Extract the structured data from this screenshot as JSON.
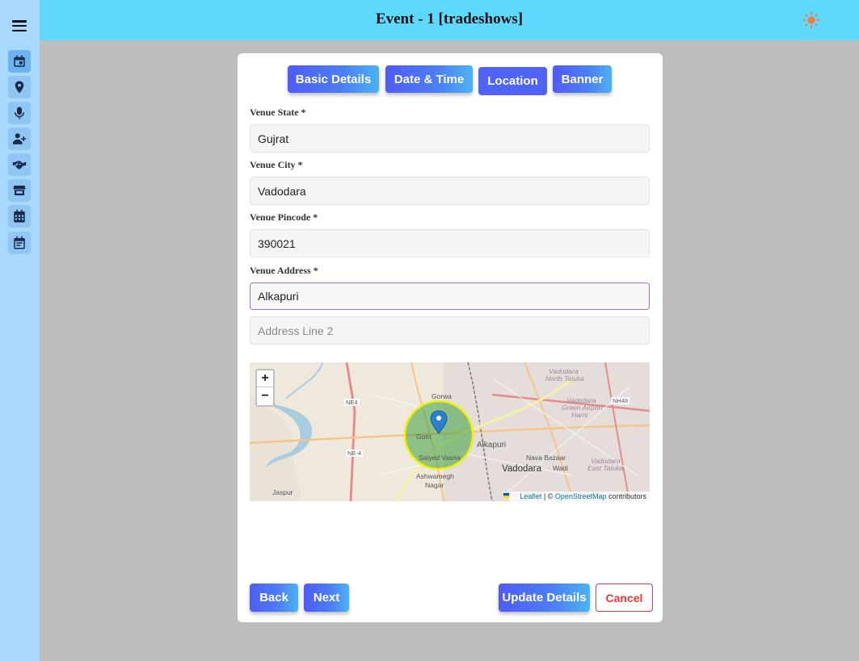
{
  "topbar": {
    "title": "Event - 1 [tradeshows]",
    "theme_icon": "sun-icon"
  },
  "sidebar": {
    "items": [
      {
        "icon": "calendar-day-icon",
        "active": true
      },
      {
        "icon": "location-pin-icon"
      },
      {
        "icon": "microphone-icon"
      },
      {
        "icon": "user-plus-icon"
      },
      {
        "icon": "handshake-icon"
      },
      {
        "icon": "store-icon"
      },
      {
        "icon": "calendar-grid-icon"
      },
      {
        "icon": "calendar-list-icon"
      }
    ]
  },
  "tabs": [
    {
      "label": "Basic Details",
      "active": false
    },
    {
      "label": "Date & Time",
      "active": false
    },
    {
      "label": "Location",
      "active": true
    },
    {
      "label": "Banner",
      "active": false
    }
  ],
  "form": {
    "state": {
      "label": "Venue State *",
      "value": "Gujrat"
    },
    "city": {
      "label": "Venue City *",
      "value": "Vadodara"
    },
    "pincode": {
      "label": "Venue Pincode *",
      "value": "390021"
    },
    "address": {
      "label": "Venue Address *",
      "value": "Alkapuri",
      "line2_placeholder": "Address Line 2"
    }
  },
  "map": {
    "zoom_in": "+",
    "zoom_out": "−",
    "attribution": {
      "leaflet": "Leaflet",
      "sep": " | © ",
      "osm": "OpenStreetMap",
      "suffix": " contributors"
    },
    "labels": {
      "gorwa": "Gorwa",
      "gotri": "Gotri",
      "sayed": "Saiyed Vasna",
      "alkapuri": "Alkapuri",
      "vadodara": "Vadodara",
      "navabazaar": "Nava Bazaar",
      "wadi": "Wadi",
      "ashwamegh": "Ashwamegh",
      "nagar": "Nagar",
      "jaspur": "Jaspur",
      "ne4a": "NE4",
      "ne4b": "NE-4",
      "nh48": "NH48",
      "north_taluka_1": "Vadodara",
      "north_taluka_2": "North Taluka",
      "green_airport_1": "Vadodara",
      "green_airport_2": "Green Airport",
      "green_airport_3": "Harni",
      "east_taluka_1": "Vadodara",
      "east_taluka_2": "East Taluka"
    }
  },
  "buttons": {
    "back": "Back",
    "next": "Next",
    "update": "Update Details",
    "cancel": "Cancel"
  }
}
